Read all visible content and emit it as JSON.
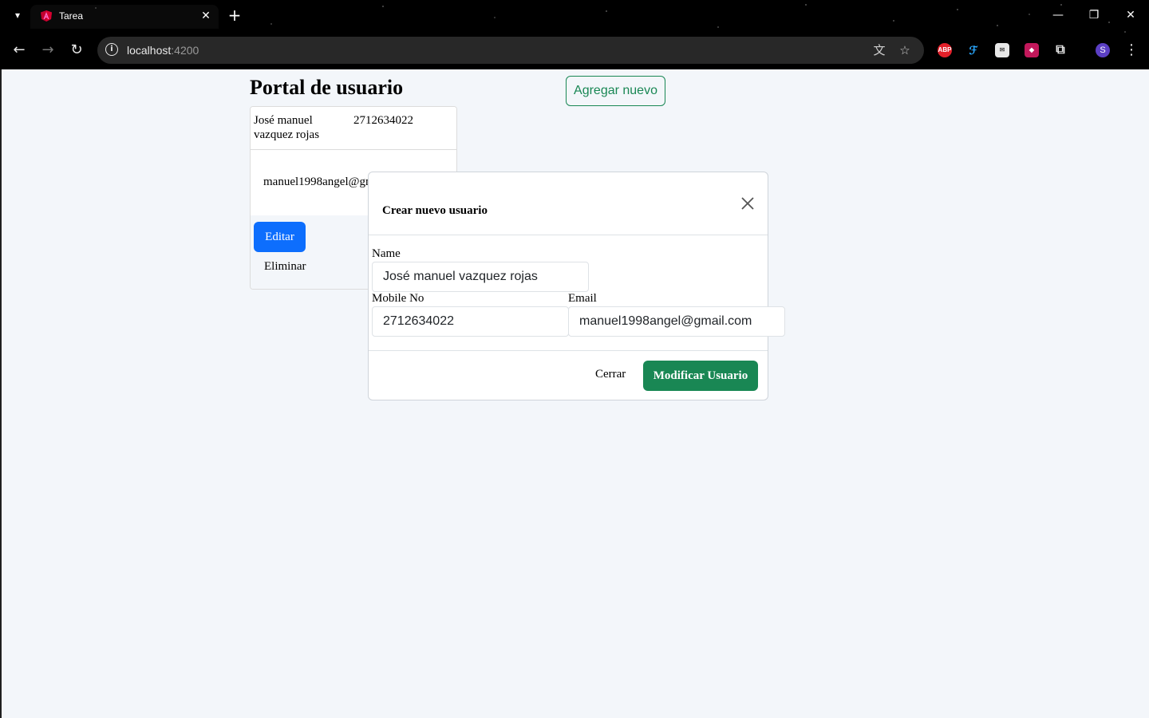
{
  "browser": {
    "tab_title": "Tarea",
    "url_host": "localhost",
    "url_port": ":4200",
    "avatar_letter": "S",
    "extensions": [
      "abp-icon",
      "translate-ext-icon",
      "mail-ext-icon",
      "pink-ext-icon",
      "extensions-puzzle-icon"
    ]
  },
  "page": {
    "title": "Portal de usuario",
    "add_button": "Agregar nuevo"
  },
  "user_card": {
    "name": "José manuel vazquez rojas",
    "phone": "2712634022",
    "email": "manuel1998angel@gmail.com",
    "edit_button": "Editar",
    "delete_button": "Eliminar"
  },
  "modal": {
    "title": "Crear nuevo usuario",
    "name_label": "Name",
    "name_value": "José manuel vazquez rojas",
    "mobile_label": "Mobile No",
    "mobile_value": "2712634022",
    "email_label": "Email",
    "email_value": "manuel1998angel@gmail.com",
    "close_button": "Cerrar",
    "submit_button": "Modificar Usuario"
  },
  "colors": {
    "primary": "#0d6efd",
    "success": "#198754",
    "page_bg": "#f3f6fa"
  }
}
